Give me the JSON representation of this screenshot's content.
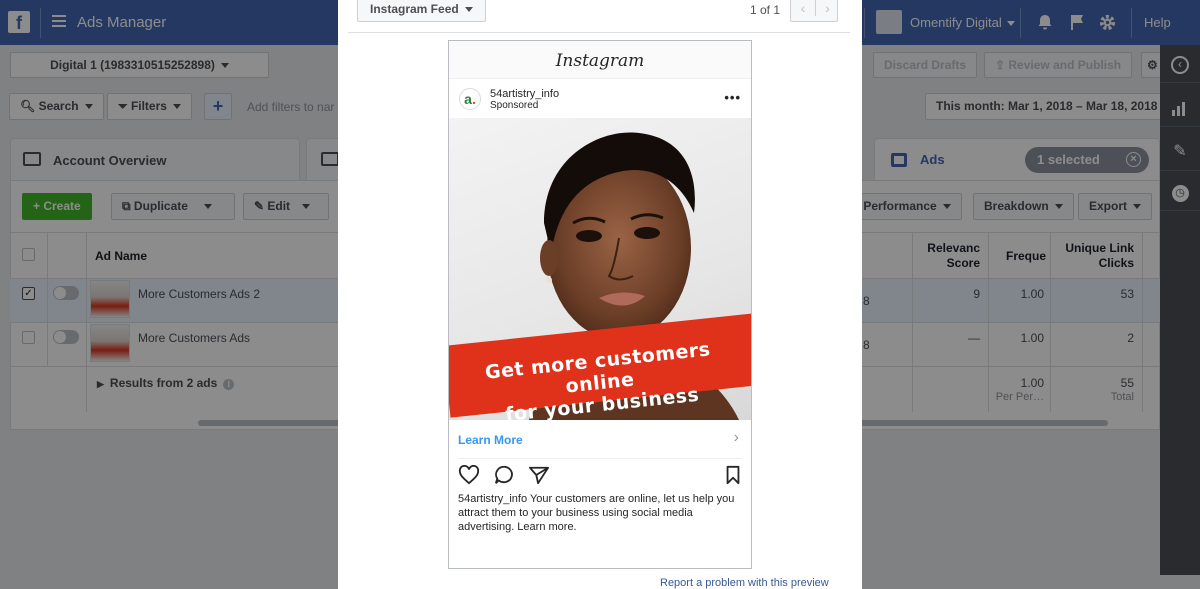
{
  "topbar": {
    "app_title": "Ads Manager",
    "business_name": "Omentify Digital",
    "help_label": "Help"
  },
  "account_selector": {
    "label": "Digital 1 (1983310515252898)"
  },
  "header_actions": {
    "discard_label": "Discard Drafts",
    "review_label": "Review and Publish"
  },
  "filter_bar": {
    "search_label": "Search",
    "filters_label": "Filters",
    "add_filter_placeholder": "Add filters to nar",
    "date_range": "This month: Mar 1, 2018 – Mar 18, 2018"
  },
  "tabs": {
    "account_overview": "Account Overview",
    "ads": "Ads",
    "selected_badge": "1 selected"
  },
  "toolbar": {
    "create": "Create",
    "duplicate": "Duplicate",
    "edit": "Edit",
    "columns": ": Performance",
    "breakdown": "Breakdown",
    "export": "Export"
  },
  "table": {
    "headers": {
      "ad_name": "Ad Name",
      "relevance": "Relevanc\nScore",
      "relevance_line1": "Relevanc",
      "relevance_line2": "Score",
      "frequency": "Freque",
      "link_clicks_line1": "Unique Link",
      "link_clicks_line2": "Clicks"
    },
    "rows": [
      {
        "name": "More Customers Ads 2",
        "left_value": "8",
        "relevance": "9",
        "frequency": "1.00",
        "link_clicks": "53",
        "selected": true
      },
      {
        "name": "More Customers Ads",
        "left_value": "8",
        "relevance": "—",
        "frequency": "1.00",
        "link_clicks": "2",
        "selected": false
      }
    ],
    "summary": {
      "label": "Results from 2 ads",
      "frequency": "1.00",
      "frequency_sub": "Per Per…",
      "link_clicks": "55",
      "link_clicks_sub": "Total"
    }
  },
  "preview": {
    "placement": "Instagram Feed",
    "pager": "1 of 1",
    "platform_header": "Instagram",
    "account": "54artistry_info",
    "sponsored": "Sponsored",
    "banner_line1": "Get more customers online",
    "banner_line2": "for your business",
    "cta": "Learn More",
    "caption_user": "54artistry_info",
    "caption_text": "Your customers are online, let us help you attract them to your business using social media advertising. Learn more.",
    "report_link": "Report a problem with this preview"
  },
  "colors": {
    "topbar": "#4267b2",
    "create_button": "#42b72a",
    "banner": "#e0311a",
    "cta": "#3897f0",
    "selected_badge": "#8d949e"
  },
  "icons": [
    "facebook-logo-icon",
    "menu-icon",
    "briefcase-icon",
    "bell-icon",
    "flag-icon",
    "gear-icon",
    "search-icon",
    "filter-icon",
    "plus-icon",
    "collapse-icon",
    "bar-chart-icon",
    "pencil-icon",
    "clock-icon",
    "heart-icon",
    "comment-icon",
    "share-icon",
    "bookmark-icon",
    "more-icon",
    "chevron-right-icon"
  ]
}
